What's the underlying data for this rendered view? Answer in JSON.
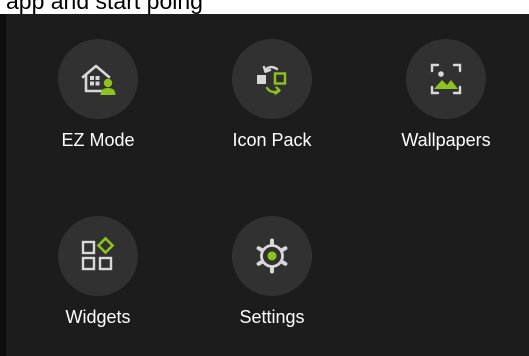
{
  "top_strip": {
    "partial_text": "app and start poing"
  },
  "colors": {
    "panel_background": "#1c1c1c",
    "tile_circle": "#313131",
    "icon_stroke": "#d8d8d8",
    "accent": "#8dc21f",
    "label": "#ffffff"
  },
  "tiles": [
    {
      "label": "EZ Mode",
      "icon": "home-user-icon"
    },
    {
      "label": "Icon Pack",
      "icon": "swap-shapes-icon"
    },
    {
      "label": "Wallpapers",
      "icon": "image-frame-icon"
    },
    {
      "label": "Widgets",
      "icon": "widgets-grid-icon"
    },
    {
      "label": "Settings",
      "icon": "gear-icon"
    }
  ]
}
